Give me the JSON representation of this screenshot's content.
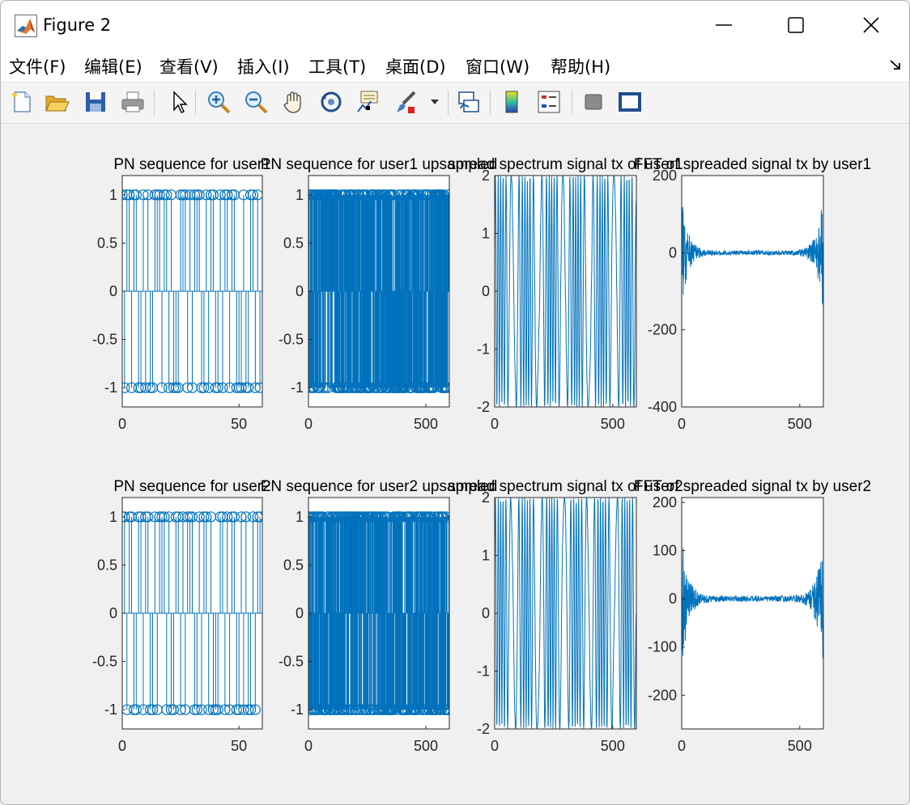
{
  "window": {
    "title": "Figure 2",
    "controls": [
      "minimize",
      "maximize",
      "close"
    ]
  },
  "menu": {
    "items": [
      "文件(F)",
      "编辑(E)",
      "查看(V)",
      "插入(I)",
      "工具(T)",
      "桌面(D)",
      "窗口(W)",
      "帮助(H)"
    ],
    "shortcut_underline": [
      "F",
      "E",
      "V",
      "I",
      "T",
      "D",
      "W",
      "H"
    ]
  },
  "toolbar": {
    "icons": [
      "new-figure-icon",
      "open-file-icon",
      "save-icon",
      "print-icon",
      "select-arrow-icon",
      "zoom-in-icon",
      "zoom-out-icon",
      "pan-icon",
      "rotate-3d-icon",
      "data-cursor-icon",
      "brush-icon",
      "brush-dropdown-icon",
      "link-plot-icon",
      "colorbar-icon",
      "legend-icon",
      "hide-plot-tools-icon",
      "show-plot-tools-icon"
    ]
  },
  "colors": {
    "line": "#0072bd",
    "axes_bg": "#ffffff",
    "figure_bg": "#f0f0f0"
  },
  "chart_data": [
    {
      "type": "stem",
      "title": "PN sequence for user1",
      "xlim": [
        0,
        60
      ],
      "ylim": [
        -1.2,
        1.2
      ],
      "xticks": [
        0,
        50
      ],
      "yticks": [
        1,
        0.5,
        0,
        -0.5,
        -1
      ],
      "ytick_labels": [
        "1",
        "0.5",
        "0",
        "-0.5",
        "-1"
      ],
      "values": [
        1,
        -1,
        1,
        1,
        -1,
        1,
        1,
        -1,
        -1,
        1,
        -1,
        1,
        -1,
        -1,
        1,
        1,
        1,
        -1,
        1,
        1,
        -1,
        1,
        -1,
        -1,
        -1,
        1,
        1,
        1,
        -1,
        1,
        -1,
        1,
        1,
        1,
        -1,
        -1,
        1,
        -1,
        1,
        1,
        -1,
        -1,
        1,
        -1,
        1,
        1,
        -1,
        1,
        1,
        -1,
        -1,
        -1,
        1,
        -1,
        -1,
        1,
        1,
        -1,
        1,
        -1
      ]
    },
    {
      "type": "stem",
      "title": "PN sequence for user1 upsampled",
      "xlim": [
        0,
        600
      ],
      "ylim": [
        -1.2,
        1.2
      ],
      "xticks": [
        0,
        500
      ],
      "yticks": [
        1,
        0.5,
        0,
        -0.5,
        -1
      ],
      "ytick_labels": [
        "1",
        "0.5",
        "0",
        "-0.5",
        "-1"
      ],
      "dense": true
    },
    {
      "type": "line",
      "title": "spread spectrum signal tx of user1",
      "xlim": [
        0,
        600
      ],
      "ylim": [
        -2,
        2
      ],
      "xticks": [
        0,
        500
      ],
      "yticks": [
        2,
        1,
        0,
        -1,
        -2
      ],
      "ytick_labels": [
        "2",
        "1",
        "0",
        "-1",
        "-2"
      ],
      "dense": true
    },
    {
      "type": "line",
      "title": "FFT of spreaded signal tx by user1",
      "xlim": [
        0,
        600
      ],
      "ylim": [
        -400,
        200
      ],
      "xticks": [
        0,
        500
      ],
      "yticks": [
        200,
        0,
        -200,
        -400
      ],
      "ytick_labels": [
        "200",
        "0",
        "-200",
        "-400"
      ],
      "dense": true
    },
    {
      "type": "stem",
      "title": "PN sequence for user2",
      "xlim": [
        0,
        60
      ],
      "ylim": [
        -1.2,
        1.2
      ],
      "xticks": [
        0,
        50
      ],
      "yticks": [
        1,
        0.5,
        0,
        -0.5,
        -1
      ],
      "ytick_labels": [
        "1",
        "0.5",
        "0",
        "-0.5",
        "-1"
      ],
      "values": [
        1,
        1,
        -1,
        1,
        1,
        -1,
        -1,
        1,
        1,
        -1,
        1,
        1,
        -1,
        -1,
        1,
        -1,
        1,
        1,
        1,
        -1,
        1,
        -1,
        -1,
        1,
        1,
        -1,
        1,
        -1,
        1,
        1,
        1,
        -1,
        -1,
        1,
        -1,
        1,
        1,
        -1,
        1,
        -1,
        -1,
        -1,
        1,
        1,
        -1,
        1,
        -1,
        1,
        1,
        -1,
        -1,
        1,
        -1,
        1,
        -1,
        -1,
        1,
        -1,
        1,
        1
      ]
    },
    {
      "type": "stem",
      "title": "PN sequence for user2 upsampled",
      "xlim": [
        0,
        600
      ],
      "ylim": [
        -1.2,
        1.2
      ],
      "xticks": [
        0,
        500
      ],
      "yticks": [
        1,
        0.5,
        0,
        -0.5,
        -1
      ],
      "ytick_labels": [
        "1",
        "0.5",
        "0",
        "-0.5",
        "-1"
      ],
      "dense": true
    },
    {
      "type": "line",
      "title": "spread spectrum signal tx of user2",
      "xlim": [
        0,
        600
      ],
      "ylim": [
        -2,
        2
      ],
      "xticks": [
        0,
        500
      ],
      "yticks": [
        2,
        1,
        0,
        -1,
        -2
      ],
      "ytick_labels": [
        "2",
        "1",
        "0",
        "-1",
        "-2"
      ],
      "dense": true
    },
    {
      "type": "line",
      "title": "FFT of spreaded signal tx by user2",
      "xlim": [
        0,
        600
      ],
      "ylim": [
        -270,
        210
      ],
      "xticks": [
        0,
        500
      ],
      "yticks": [
        200,
        100,
        0,
        -100,
        -200
      ],
      "ytick_labels": [
        "200",
        "100",
        "0",
        "-100",
        "-200"
      ],
      "dense": true
    }
  ]
}
